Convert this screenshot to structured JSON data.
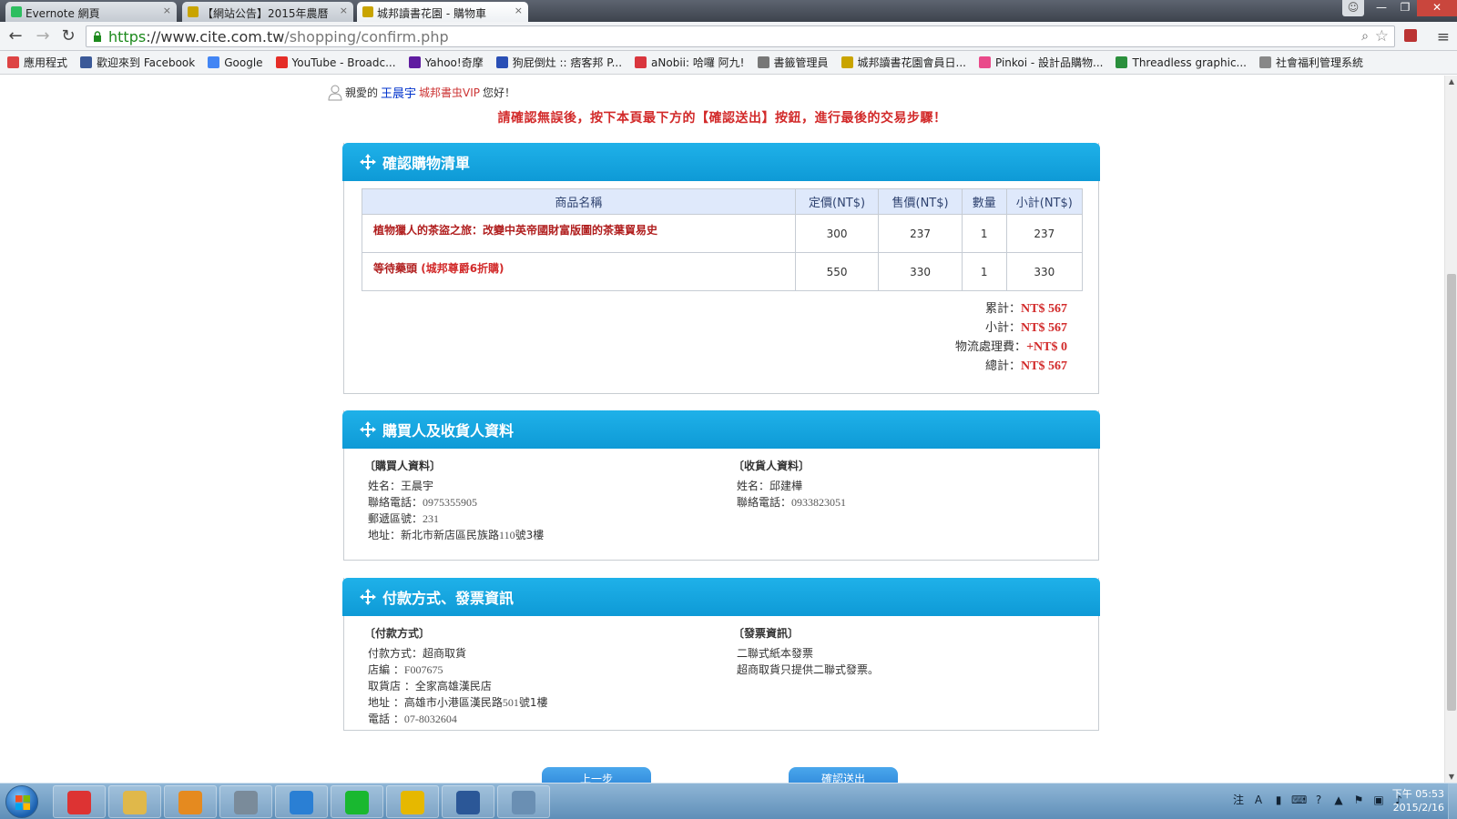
{
  "browser": {
    "tabs": [
      {
        "label": "Evernote 網頁",
        "color": "#2dbe60"
      },
      {
        "label": "【網站公告】2015年農曆",
        "color": "#c9a400"
      },
      {
        "label": "城邦讀書花園 - 購物車",
        "color": "#c9a400"
      }
    ],
    "url": {
      "protocol": "https",
      "domain": "://www.cite.com.tw",
      "path": "/shopping/confirm.php"
    },
    "bookmarks": [
      {
        "label": "應用程式",
        "icon": "apps-grid-icon",
        "color": "#d44"
      },
      {
        "label": "歡迎來到 Facebook",
        "icon": "facebook-icon",
        "color": "#3b5998"
      },
      {
        "label": "Google",
        "icon": "google-icon",
        "color": "#4285f4"
      },
      {
        "label": "YouTube - Broadc...",
        "icon": "youtube-icon",
        "color": "#e52d27"
      },
      {
        "label": "Yahoo!奇摩",
        "icon": "yahoo-icon",
        "color": "#5f1ca0"
      },
      {
        "label": "狗屁倒灶 :: 痞客邦 P...",
        "icon": "blog-icon",
        "color": "#2a4fb5"
      },
      {
        "label": "aNobii: 哈囉 阿九!",
        "icon": "anobii-icon",
        "color": "#d9363e"
      },
      {
        "label": "書籤管理員",
        "icon": "star-icon",
        "color": "#777"
      },
      {
        "label": "城邦讀書花園會員日...",
        "icon": "cite-icon",
        "color": "#c9a400"
      },
      {
        "label": "Pinkoi - 設計品購物...",
        "icon": "pinkoi-icon",
        "color": "#e94a8a"
      },
      {
        "label": "Threadless graphic...",
        "icon": "threadless-icon",
        "color": "#2a8f3c"
      },
      {
        "label": "社會福利管理系統",
        "icon": "page-icon",
        "color": "#888"
      }
    ]
  },
  "page": {
    "greeting": {
      "prefix": "親愛的",
      "name": "王晨宇",
      "level": "城邦書虫VIP",
      "suffix": "您好！"
    },
    "notice": "請確認無誤後，按下本頁最下方的【確認送出】按鈕，進行最後的交易步驟！",
    "cart": {
      "title": "確認購物清單",
      "headers": [
        "商品名稱",
        "定價(NT$)",
        "售價(NT$)",
        "數量",
        "小計(NT$)"
      ],
      "rows": [
        {
          "name": "植物獵人的茶盜之旅：改變中英帝國財富版圖的茶葉貿易史",
          "promo": "",
          "list_price": "300",
          "price": "237",
          "qty": "1",
          "subtotal": "237"
        },
        {
          "name": "等待藥頭",
          "promo": "(城邦尊爵6折購)",
          "list_price": "550",
          "price": "330",
          "qty": "1",
          "subtotal": "330"
        }
      ],
      "totals": [
        {
          "label": "累計：",
          "value": "NT$ 567"
        },
        {
          "label": "小計：",
          "value": "NT$ 567"
        },
        {
          "label": "物流處理費：",
          "value": "+NT$ 0"
        },
        {
          "label": "總計：",
          "value": "NT$ 567"
        }
      ]
    },
    "contact": {
      "title": "購買人及收貨人資料",
      "buyer_heading": "〔購買人資料〕",
      "buyer_name": "姓名：王晨宇",
      "buyer_phone_label": "聯絡電話：",
      "buyer_phone": "0975355905",
      "buyer_zip_label": "郵遞區號：",
      "buyer_zip": "231",
      "buyer_addr_label": "地址：新北市新店區民族路",
      "buyer_addr_num": "110",
      "buyer_addr_tail": "號3樓",
      "recv_heading": "〔收貨人資料〕",
      "recv_name": "姓名：邱建樺",
      "recv_phone_label": "聯絡電話：",
      "recv_phone": "0933823051"
    },
    "payment": {
      "title": "付款方式、發票資訊",
      "pay_heading": "〔付款方式〕",
      "pay_method": "付款方式：超商取貨",
      "store_id_label": "店編 ：",
      "store_id": "F007675",
      "store_label": "取貨店 ：全家高雄漢民店",
      "addr_label": "地址 ：高雄市小港區漢民路",
      "addr_num": "501",
      "addr_tail": "號1樓",
      "phone_label": "電話 ：",
      "phone": "07-8032604",
      "inv_heading": "〔發票資訊〕",
      "inv_type": "二聯式紙本發票",
      "inv_note": "超商取貨只提供二聯式發票。"
    },
    "buttons": {
      "prev": "上一步",
      "confirm": "確認送出"
    }
  },
  "taskbar": {
    "clock_time": "下午 05:53",
    "clock_date": "2015/2/16",
    "apps": [
      {
        "name": "chrome-icon",
        "color": "#d33"
      },
      {
        "name": "explorer-icon",
        "color": "#e0b84a"
      },
      {
        "name": "outlook-icon",
        "color": "#e58a1f"
      },
      {
        "name": "calculator-icon",
        "color": "#7a8b9a"
      },
      {
        "name": "ie-icon",
        "color": "#2a7fd4"
      },
      {
        "name": "line-icon",
        "color": "#19b830"
      },
      {
        "name": "yellow-app-icon",
        "color": "#e6b800"
      },
      {
        "name": "word-icon",
        "color": "#2b5797"
      },
      {
        "name": "paint-icon",
        "color": "#6a8fb3"
      }
    ]
  },
  "colors": {
    "accent": "#0e9ad6",
    "alert": "#d22a2a",
    "header_bg": "#dfe9fb"
  }
}
